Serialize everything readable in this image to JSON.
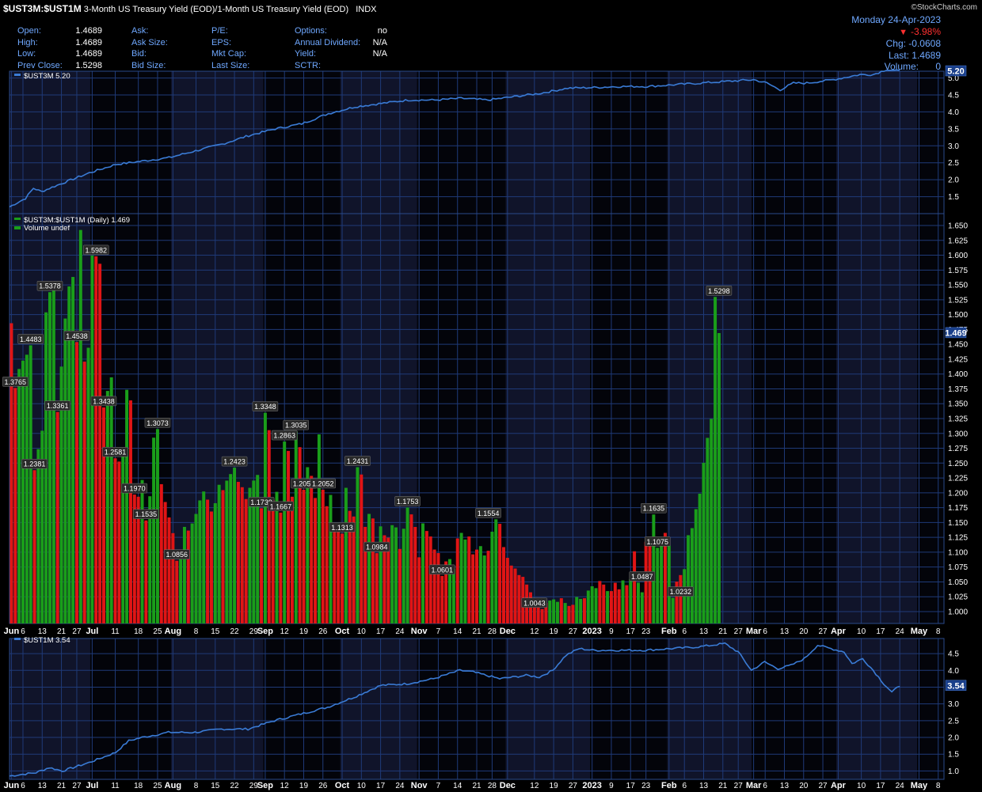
{
  "header": {
    "symbol": "$UST3M:$UST1M",
    "title": "3-Month US Treasury Yield (EOD)/1-Month US Treasury Yield (EOD)",
    "exchange": "INDX",
    "logo": "©StockCharts.com",
    "date": "Monday  24-Apr-2023",
    "change_pct": "-3.98%",
    "chg": "Chg: -0.0608",
    "last": "Last: 1.4689",
    "volume_label": "Volume:",
    "volume_value": "0"
  },
  "quote": {
    "col1_labels": [
      "Open:",
      "High:",
      "Low:",
      "Prev Close:"
    ],
    "col1_values": [
      "1.4689",
      "1.4689",
      "1.4689",
      "1.5298"
    ],
    "col2_labels": [
      "Ask:",
      "Ask Size:",
      "Bid:",
      "Bid Size:"
    ],
    "col3_labels": [
      "P/E:",
      "EPS:",
      "Mkt Cap:",
      "Last Size:"
    ],
    "col4_labels": [
      "Options:",
      "Annual Dividend:",
      "Yield:",
      "SCTR:"
    ],
    "col4_values": [
      "no",
      "N/A",
      "N/A",
      ""
    ]
  },
  "colors": {
    "background": "#000000",
    "grid": "#1f3a78",
    "line": "#3a7bd5",
    "up_bar": "#1a9e1a",
    "down_bar": "#e01515",
    "band_light": "#10142a",
    "band_dark": "#03040a"
  },
  "chart_data": [
    {
      "type": "line",
      "panel": "top",
      "legend": "$UST3M 5.20",
      "last_value_label": "5.20",
      "ylim": [
        1.0,
        5.2
      ],
      "yticks": [
        "1.5",
        "2.0",
        "2.5",
        "3.0",
        "3.5",
        "4.0",
        "4.5",
        "5.0"
      ],
      "series": [
        {
          "name": "$UST3M",
          "keypoints": [
            [
              0,
              1.2
            ],
            [
              6,
              1.45
            ],
            [
              9,
              1.75
            ],
            [
              12,
              1.65
            ],
            [
              20,
              1.9
            ],
            [
              30,
              2.2
            ],
            [
              40,
              2.45
            ],
            [
              50,
              2.55
            ],
            [
              60,
              2.65
            ],
            [
              70,
              2.85
            ],
            [
              80,
              3.05
            ],
            [
              90,
              3.3
            ],
            [
              100,
              3.5
            ],
            [
              110,
              3.65
            ],
            [
              120,
              3.95
            ],
            [
              130,
              4.15
            ],
            [
              140,
              4.25
            ],
            [
              150,
              4.35
            ],
            [
              160,
              4.35
            ],
            [
              170,
              4.4
            ],
            [
              180,
              4.35
            ],
            [
              190,
              4.45
            ],
            [
              200,
              4.55
            ],
            [
              210,
              4.7
            ],
            [
              220,
              4.72
            ],
            [
              230,
              4.75
            ],
            [
              240,
              4.75
            ],
            [
              250,
              4.8
            ],
            [
              260,
              4.85
            ],
            [
              270,
              4.9
            ],
            [
              280,
              4.95
            ],
            [
              285,
              4.85
            ],
            [
              290,
              4.65
            ],
            [
              295,
              4.85
            ],
            [
              300,
              4.85
            ],
            [
              310,
              4.95
            ],
            [
              320,
              5.1
            ],
            [
              325,
              5.1
            ],
            [
              330,
              5.25
            ],
            [
              335,
              5.2
            ]
          ]
        }
      ]
    },
    {
      "type": "bar",
      "panel": "main",
      "legend": "$UST3M:$UST1M (Daily) 1.469",
      "sublegend": "Volume undef",
      "last_value_label": "1.469",
      "ylim": [
        0.98,
        1.67
      ],
      "yticks": [
        "1.000",
        "1.025",
        "1.050",
        "1.075",
        "1.100",
        "1.125",
        "1.150",
        "1.175",
        "1.200",
        "1.225",
        "1.250",
        "1.275",
        "1.300",
        "1.325",
        "1.350",
        "1.375",
        "1.400",
        "1.425",
        "1.450",
        "1.475",
        "1.500",
        "1.525",
        "1.550",
        "1.575",
        "1.600",
        "1.625",
        "1.650"
      ],
      "values": [
        1.4855,
        1.3765,
        1.4085,
        1.4225,
        1.4325,
        1.4483,
        1.2381,
        1.2735,
        1.3045,
        1.5038,
        1.5378,
        1.5434,
        1.3361,
        1.4125,
        1.4934,
        1.5475,
        1.5634,
        1.4538,
        1.6425,
        1.4208,
        1.4442,
        1.5995,
        1.5982,
        1.5856,
        1.3438,
        1.3715,
        1.3944,
        1.2581,
        1.2526,
        1.2665,
        1.3734,
        1.3556,
        1.197,
        1.1934,
        1.2215,
        1.1535,
        1.1942,
        1.2928,
        1.3073,
        1.2145,
        1.1845,
        1.1585,
        1.1321,
        1.0856,
        1.1034,
        1.1426,
        1.1364,
        1.1484,
        1.1644,
        1.1872,
        1.2022,
        1.1885,
        1.1685,
        1.1825,
        1.2135,
        1.2045,
        1.2205,
        1.2315,
        1.2423,
        1.2184,
        1.2094,
        1.1895,
        1.2084,
        1.2206,
        1.2301,
        1.1739,
        1.3348,
        1.3055,
        1.1884,
        1.2016,
        1.1667,
        1.2863,
        1.2705,
        1.1934,
        1.3035,
        1.2768,
        1.2051,
        1.2431,
        1.2285,
        1.1913,
        1.2984,
        1.2052,
        1.1774,
        1.1964,
        1.1404,
        1.1381,
        1.1313,
        1.2084,
        1.1696,
        1.1601,
        1.2431,
        1.2308,
        1.1426,
        1.1645,
        1.1568,
        1.0984,
        1.1435,
        1.1285,
        1.1245,
        1.1455,
        1.1418,
        1.1055,
        1.1395,
        1.1753,
        1.1637,
        1.1425,
        1.0914,
        1.1485,
        1.1357,
        1.1265,
        1.1045,
        1.0985,
        1.0601,
        1.0845,
        1.0884,
        1.0724,
        1.1232,
        1.1325,
        1.1214,
        1.1265,
        1.0964,
        1.1044,
        1.1102,
        1.0945,
        1.1024,
        1.1345,
        1.1554,
        1.1478,
        1.1086,
        1.0905,
        1.0775,
        1.0725,
        1.0615,
        1.0585,
        1.0455,
        1.0325,
        1.0205,
        1.0143,
        1.0043,
        1.0145,
        1.0186,
        1.0205,
        1.0164,
        1.0225,
        1.0145,
        1.0095,
        1.0114,
        1.0246,
        1.0214,
        1.0225,
        1.0354,
        1.0426,
        1.0395,
        1.0515,
        1.0455,
        1.0345,
        1.0345,
        1.0485,
        1.0375,
        1.0525,
        1.0445,
        1.0545,
        1.1015,
        1.0487,
        1.0325,
        1.1175,
        1.1245,
        1.1635,
        1.1075,
        1.1245,
        1.1325,
        1.1114,
        1.0232,
        1.0505,
        1.0615,
        1.0715,
        1.1286,
        1.1405,
        1.1725,
        1.1985,
        1.2505,
        1.2925,
        1.3245,
        1.5298,
        1.4689
      ],
      "down_flags": [
        1,
        1,
        0,
        0,
        0,
        0,
        1,
        0,
        0,
        0,
        0,
        0,
        1,
        0,
        0,
        0,
        0,
        1,
        0,
        1,
        0,
        0,
        1,
        1,
        1,
        0,
        0,
        1,
        1,
        0,
        0,
        1,
        1,
        1,
        0,
        1,
        0,
        0,
        0,
        1,
        1,
        1,
        1,
        1,
        0,
        0,
        1,
        0,
        0,
        0,
        0,
        1,
        1,
        0,
        0,
        1,
        0,
        0,
        0,
        1,
        1,
        1,
        0,
        0,
        0,
        1,
        0,
        1,
        1,
        0,
        1,
        0,
        1,
        1,
        0,
        1,
        1,
        0,
        1,
        1,
        0,
        1,
        1,
        0,
        1,
        1,
        1,
        0,
        1,
        1,
        0,
        1,
        1,
        0,
        1,
        1,
        0,
        1,
        1,
        0,
        0,
        1,
        0,
        0,
        1,
        1,
        1,
        0,
        1,
        1,
        1,
        1,
        1,
        1,
        0,
        0,
        1,
        0,
        0,
        1,
        1,
        1,
        0,
        0,
        1,
        0,
        0,
        1,
        1,
        1,
        1,
        1,
        1,
        1,
        1,
        1,
        1,
        1,
        1,
        1,
        0,
        0,
        0,
        1,
        0,
        1,
        1,
        0,
        0,
        1,
        0,
        0,
        0,
        1,
        1,
        0,
        1,
        1,
        1,
        0,
        1,
        0,
        1,
        0,
        0,
        1,
        1,
        0,
        0,
        0,
        1,
        0,
        0,
        1,
        1,
        0,
        0,
        0,
        0,
        0,
        0,
        0,
        0,
        0,
        0,
        0,
        1
      ],
      "point_labels": [
        [
          "1.3765",
          1
        ],
        [
          "1.4483",
          5
        ],
        [
          "1.2381",
          6
        ],
        [
          "1.5378",
          10
        ],
        [
          "1.3361",
          12
        ],
        [
          "1.4538",
          17
        ],
        [
          "1.5982",
          22
        ],
        [
          "1.3438",
          24
        ],
        [
          "1.2581",
          27
        ],
        [
          "1.1970",
          32
        ],
        [
          "1.3073",
          38
        ],
        [
          "1.1535",
          35
        ],
        [
          "1.0856",
          43
        ],
        [
          "1.2423",
          58
        ],
        [
          "1.1739",
          65
        ],
        [
          "1.3348",
          66
        ],
        [
          "1.2863",
          71
        ],
        [
          "1.1667",
          70
        ],
        [
          "1.3035",
          74
        ],
        [
          "1.2051",
          76
        ],
        [
          "1.2052",
          81
        ],
        [
          "1.1313",
          86
        ],
        [
          "1.2431",
          90
        ],
        [
          "1.0984",
          95
        ],
        [
          "1.1753",
          103
        ],
        [
          "1.0601",
          112
        ],
        [
          "1.1554",
          124
        ],
        [
          "1.0043",
          136
        ],
        [
          "1.0487",
          164
        ],
        [
          "1.1635",
          167
        ],
        [
          "1.1075",
          168
        ],
        [
          "1.0232",
          174
        ],
        [
          "1.5298",
          184
        ]
      ],
      "x_ticks": [
        [
          "Jun",
          0
        ],
        [
          "6",
          3
        ],
        [
          "13",
          8
        ],
        [
          "21",
          13
        ],
        [
          "27",
          17
        ],
        [
          "Jul",
          21
        ],
        [
          "11",
          27
        ],
        [
          "18",
          33
        ],
        [
          "25",
          38
        ],
        [
          "Aug",
          42
        ],
        [
          "8",
          48
        ],
        [
          "15",
          53
        ],
        [
          "22",
          58
        ],
        [
          "29",
          63
        ],
        [
          "Sep",
          66
        ],
        [
          "12",
          71
        ],
        [
          "19",
          76
        ],
        [
          "26",
          81
        ],
        [
          "Oct",
          86
        ],
        [
          "10",
          91
        ],
        [
          "17",
          96
        ],
        [
          "24",
          101
        ],
        [
          "Nov",
          106
        ],
        [
          "7",
          111
        ],
        [
          "14",
          116
        ],
        [
          "21",
          121
        ],
        [
          "28",
          125
        ],
        [
          "Dec",
          129
        ],
        [
          "12",
          136
        ],
        [
          "19",
          141
        ],
        [
          "27",
          146
        ],
        [
          "2023",
          151
        ],
        [
          "9",
          156
        ],
        [
          "17",
          161
        ],
        [
          "23",
          165
        ],
        [
          "Feb",
          171
        ],
        [
          "6",
          175
        ],
        [
          "13",
          180
        ],
        [
          "21",
          185
        ],
        [
          "27",
          189
        ],
        [
          "Mar",
          193
        ],
        [
          "6",
          196
        ],
        [
          "13",
          201
        ],
        [
          "20",
          206
        ],
        [
          "27",
          211
        ],
        [
          "Apr",
          215
        ],
        [
          "10",
          221
        ],
        [
          "17",
          226
        ],
        [
          "24",
          231
        ],
        [
          "May",
          236
        ],
        [
          "8",
          241
        ]
      ]
    },
    {
      "type": "line",
      "panel": "bottom",
      "legend": "$UST1M 3.54",
      "last_value_label": "3.54",
      "ylim": [
        0.75,
        4.95
      ],
      "yticks": [
        "1.0",
        "1.5",
        "2.0",
        "2.5",
        "3.0",
        "3.5",
        "4.0",
        "4.5"
      ],
      "series": [
        {
          "name": "$UST1M",
          "keypoints": [
            [
              0,
              0.85
            ],
            [
              10,
              0.95
            ],
            [
              15,
              1.1
            ],
            [
              20,
              1.0
            ],
            [
              30,
              1.25
            ],
            [
              40,
              1.55
            ],
            [
              45,
              1.9
            ],
            [
              50,
              2.0
            ],
            [
              60,
              2.15
            ],
            [
              70,
              2.15
            ],
            [
              80,
              2.25
            ],
            [
              90,
              2.25
            ],
            [
              100,
              2.5
            ],
            [
              110,
              2.7
            ],
            [
              120,
              2.9
            ],
            [
              130,
              3.2
            ],
            [
              140,
              3.55
            ],
            [
              150,
              3.6
            ],
            [
              160,
              3.75
            ],
            [
              170,
              4.0
            ],
            [
              175,
              3.95
            ],
            [
              180,
              3.85
            ],
            [
              185,
              3.75
            ],
            [
              190,
              3.8
            ],
            [
              195,
              3.85
            ],
            [
              200,
              3.8
            ],
            [
              205,
              4.0
            ],
            [
              210,
              4.45
            ],
            [
              215,
              4.65
            ],
            [
              220,
              4.6
            ],
            [
              240,
              4.6
            ],
            [
              250,
              4.65
            ],
            [
              260,
              4.7
            ],
            [
              265,
              4.75
            ],
            [
              270,
              4.8
            ],
            [
              275,
              4.55
            ],
            [
              280,
              4.0
            ],
            [
              285,
              4.25
            ],
            [
              290,
              4.05
            ],
            [
              295,
              4.15
            ],
            [
              300,
              4.35
            ],
            [
              305,
              4.75
            ],
            [
              310,
              4.65
            ],
            [
              315,
              4.55
            ],
            [
              318,
              4.2
            ],
            [
              322,
              4.35
            ],
            [
              326,
              4.0
            ],
            [
              330,
              3.6
            ],
            [
              333,
              3.35
            ],
            [
              336,
              3.54
            ]
          ]
        }
      ]
    }
  ]
}
